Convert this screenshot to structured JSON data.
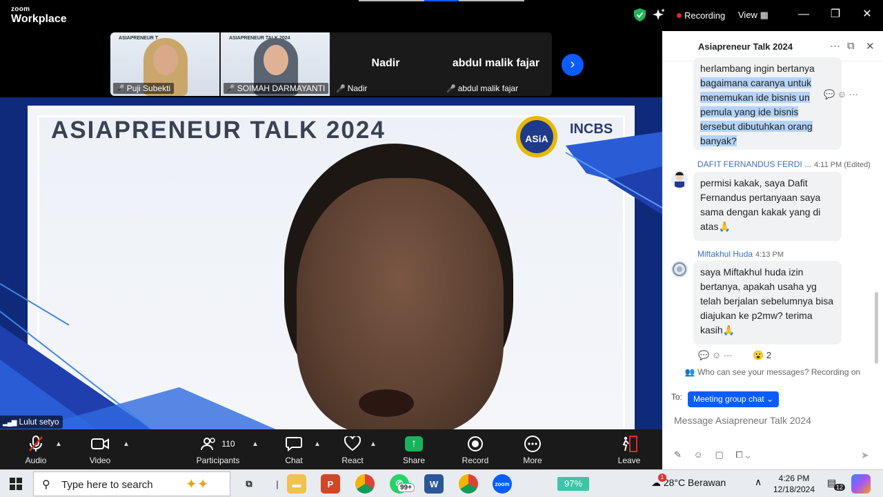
{
  "titlebar": {
    "brand_line1": "zoom",
    "brand_line2": "Workplace",
    "recording_label": "Recording",
    "view_label": "View"
  },
  "thumbnails": [
    {
      "name": "Puji Subekti",
      "slide_title": "ASIAPRENEUR T",
      "type": "video"
    },
    {
      "name": "SOIMAH DARMAYANTI",
      "slide_title": "ASIAPRENEUR TALK 2024",
      "type": "video"
    },
    {
      "name": "Nadir",
      "display_name": "Nadir",
      "type": "name"
    },
    {
      "name": "abdul malik fajar",
      "display_name": "abdul malik fajar",
      "type": "name"
    }
  ],
  "main_video": {
    "slide_title": "ASIAPRENEUR TALK 2024",
    "logo_asia": "ASiA",
    "logo_incbs": "INCBS",
    "speaker_name": "Lulut setyo"
  },
  "toolbar": {
    "audio": "Audio",
    "video": "Video",
    "participants": "Participants",
    "participant_count": "110",
    "chat": "Chat",
    "react": "React",
    "share": "Share",
    "record": "Record",
    "more": "More",
    "leave": "Leave"
  },
  "chat": {
    "title": "Asiapreneur Talk 2024",
    "messages": [
      {
        "text_lines": [
          "herlambang ingin bertanya",
          "bagaimana caranya untuk",
          "menemukan ide bisnis un",
          "pemula yang ide bisnis",
          "tersebut dibutuhkan orang",
          "banyak?"
        ]
      },
      {
        "sender": "DAFIT FERNANDUS FERDI ...",
        "time": "4:11 PM (Edited)",
        "text": "permisi kakak, saya Dafit Fernandus pertanyaan saya sama dengan kakak yang di atas🙏"
      },
      {
        "sender": "Miftakhul Huda",
        "time": "4:13 PM",
        "text": "saya Miftakhul huda izin bertanya, apakah usaha yg telah berjalan sebelumnya bisa diajukan ke p2mw? terima kasih🙏",
        "reaction_emoji": "😮",
        "reaction_count": "2"
      }
    ],
    "notice": "Who can see your messages? Recording on",
    "to_label": "To:",
    "to_value": "Meeting group chat",
    "input_placeholder": "Message Asiapreneur Talk 2024"
  },
  "taskbar": {
    "search_placeholder": "Type here to search",
    "whatsapp_badge": "99+",
    "battery": "97%",
    "weather_badge": "1",
    "weather": "28°C  Berawan",
    "time": "4:26 PM",
    "date": "12/18/2024",
    "notifications": "12"
  },
  "colors": {
    "accent": "#0b5cff",
    "recording": "#e02828",
    "share": "#17b35c",
    "highlight": "#b4d3f7"
  }
}
